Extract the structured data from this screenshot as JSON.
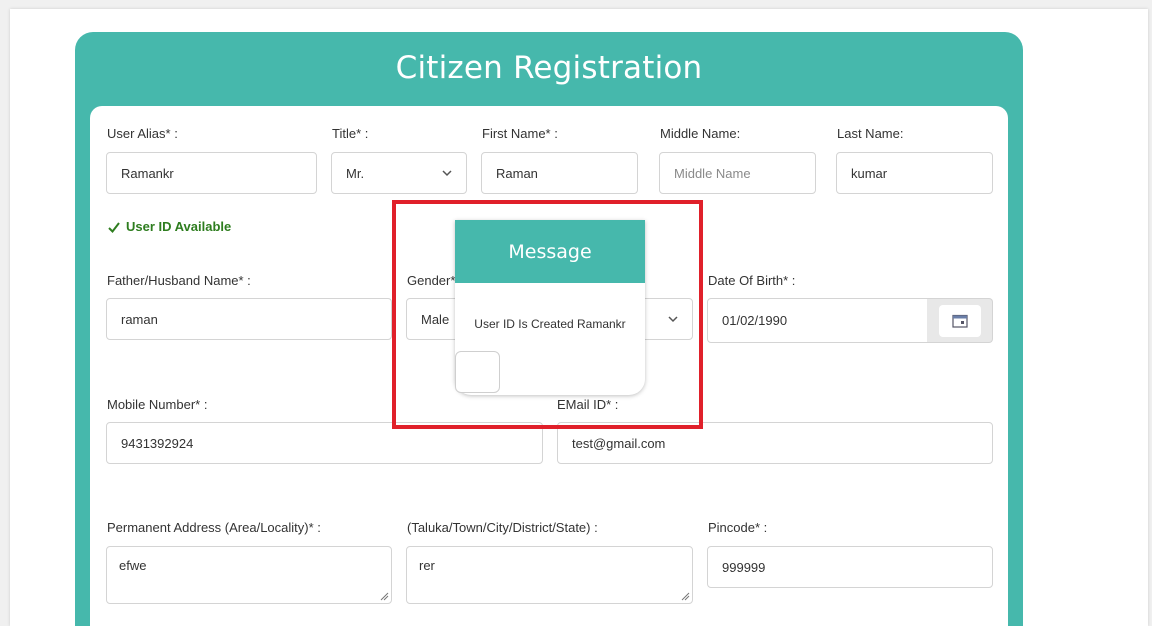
{
  "page": {
    "title": "Citizen Registration"
  },
  "fields": {
    "user_alias": {
      "label": "User Alias* :",
      "value": "Ramankr"
    },
    "title": {
      "label": "Title* :",
      "value": "Mr."
    },
    "first_name": {
      "label": "First Name* :",
      "value": "Raman"
    },
    "middle_name": {
      "label": "Middle Name:",
      "placeholder": "Middle Name",
      "value": ""
    },
    "last_name": {
      "label": "Last Name:",
      "value": "kumar"
    },
    "father_name": {
      "label": "Father/Husband Name* :",
      "value": "raman"
    },
    "gender": {
      "label": "Gender*",
      "value": "Male"
    },
    "dob": {
      "label": "Date Of Birth* :",
      "value": "01/02/1990"
    },
    "mobile": {
      "label": "Mobile Number* :",
      "value": "9431392924"
    },
    "email": {
      "label": "EMail ID* :",
      "value": "test@gmail.com"
    },
    "address": {
      "label": "Permanent Address (Area/Locality)* :",
      "value": "efwe"
    },
    "city": {
      "label": "(Taluka/Town/City/District/State) :",
      "value": "rer"
    },
    "pincode": {
      "label": "Pincode* :",
      "value": "999999"
    }
  },
  "availability": {
    "text": "User ID Available",
    "color": "#2e7d1f"
  },
  "modal": {
    "title": "Message",
    "message": "User ID Is Created Ramankr"
  },
  "colors": {
    "accent": "#46b8ac",
    "highlight": "#e0202a"
  },
  "icons": {
    "select_arrow": "chevron-down-icon",
    "calendar": "calendar-icon",
    "check": "checkmark-icon",
    "resize": "resize-grip-icon"
  }
}
